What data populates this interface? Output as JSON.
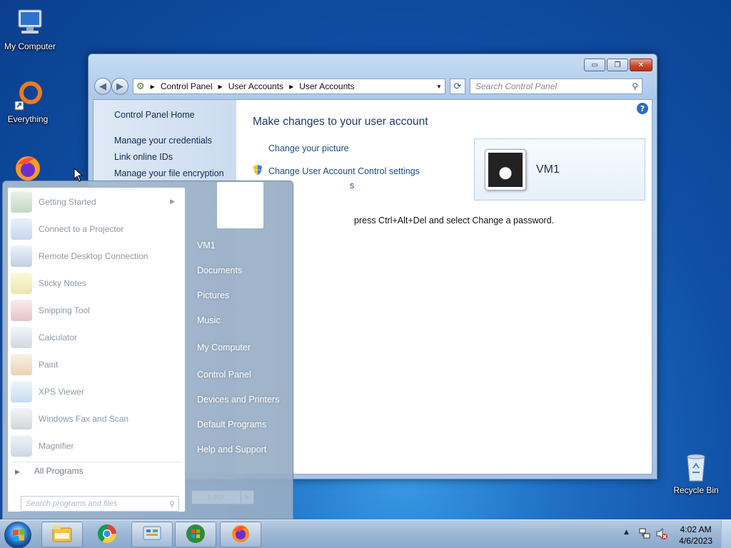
{
  "desktop": {
    "icons": [
      {
        "label": "My Computer",
        "icon": "computer-icon"
      },
      {
        "label": "Everything",
        "icon": "everything-search-icon"
      },
      {
        "label": "Recycle Bin",
        "icon": "recycle-bin-icon"
      }
    ]
  },
  "window": {
    "buttons": {
      "minimize": "▭",
      "maximize": "❐",
      "close": "✕"
    },
    "address": {
      "crumbs": [
        "Control Panel",
        "User Accounts",
        "User Accounts"
      ]
    },
    "search_placeholder": "Search Control Panel",
    "left_pane": {
      "home": "Control Panel Home",
      "links": [
        "Manage your credentials",
        "Link online IDs",
        "Manage your file encryption"
      ]
    },
    "main": {
      "title": "Make changes to your user account",
      "links": [
        "Change your picture",
        "Change User Account Control settings"
      ],
      "partial_link": "s",
      "note": "press Ctrl+Alt+Del and select Change a password."
    },
    "user": {
      "name": "VM1"
    }
  },
  "start_menu": {
    "programs": [
      {
        "label": "Getting Started",
        "icon": "getting-started-icon",
        "has_submenu": true
      },
      {
        "label": "Connect to a Projector",
        "icon": "projector-icon"
      },
      {
        "label": "Remote Desktop Connection",
        "icon": "remote-desktop-icon"
      },
      {
        "label": "Sticky Notes",
        "icon": "sticky-notes-icon"
      },
      {
        "label": "Snipping Tool",
        "icon": "snipping-tool-icon"
      },
      {
        "label": "Calculator",
        "icon": "calculator-icon"
      },
      {
        "label": "Paint",
        "icon": "paint-icon"
      },
      {
        "label": "XPS Viewer",
        "icon": "xps-viewer-icon"
      },
      {
        "label": "Windows Fax and Scan",
        "icon": "fax-scan-icon"
      },
      {
        "label": "Magnifier",
        "icon": "magnifier-icon"
      }
    ],
    "all_programs": "All Programs",
    "search_placeholder": "Search programs and files",
    "right_items": [
      "VM1",
      "Documents",
      "Pictures",
      "Music",
      "My Computer",
      "Control Panel",
      "Devices and Printers",
      "Default Programs",
      "Help and Support"
    ],
    "lock_label": "Lock"
  },
  "taskbar": {
    "apps": [
      "file-explorer-icon",
      "chrome-icon",
      "control-panel-icon",
      "windows-store-icon",
      "firefox-icon"
    ],
    "clock": {
      "time": "4:02 AM",
      "date": "4/6/2023"
    },
    "tray_icons": [
      "show-hidden-icons-icon",
      "network-icon",
      "volume-muted-icon"
    ]
  },
  "colors": {
    "accent": "#1f6fc4",
    "link": "#1a4e8a",
    "title": "#1e3a6d"
  }
}
